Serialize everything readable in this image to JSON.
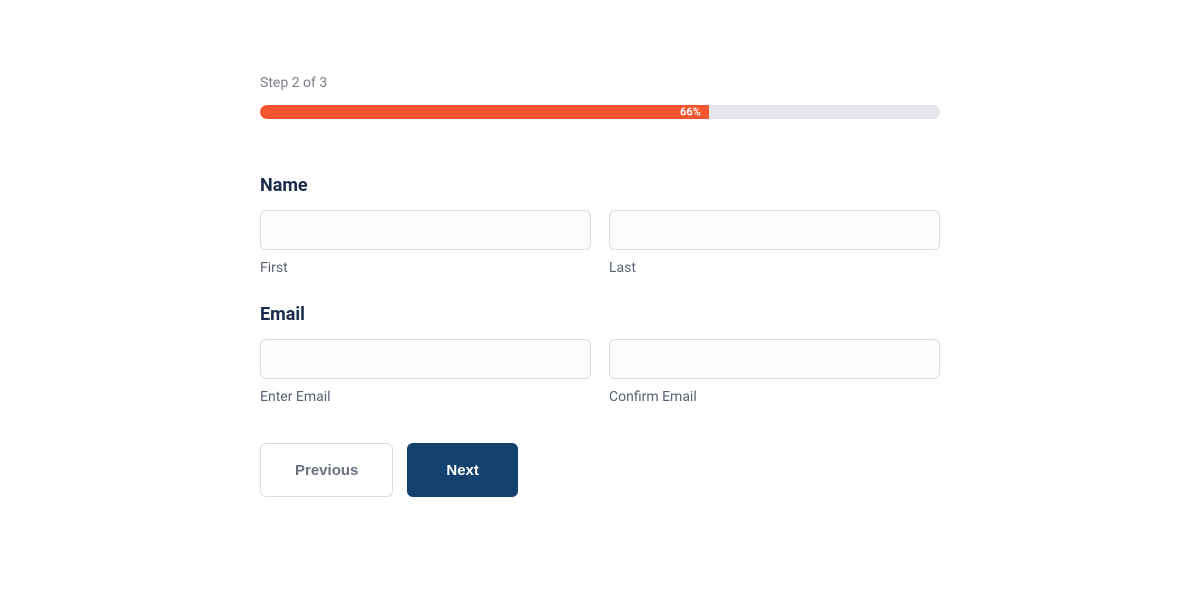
{
  "progress": {
    "step_label": "Step 2 of 3",
    "percent_text": "66%",
    "fill_width": "66%"
  },
  "sections": {
    "name": {
      "title": "Name",
      "first_label": "First",
      "last_label": "Last"
    },
    "email": {
      "title": "Email",
      "enter_label": "Enter Email",
      "confirm_label": "Confirm Email"
    }
  },
  "buttons": {
    "previous": "Previous",
    "next": "Next"
  },
  "colors": {
    "accent": "#f3552e",
    "primary": "#14426e"
  }
}
